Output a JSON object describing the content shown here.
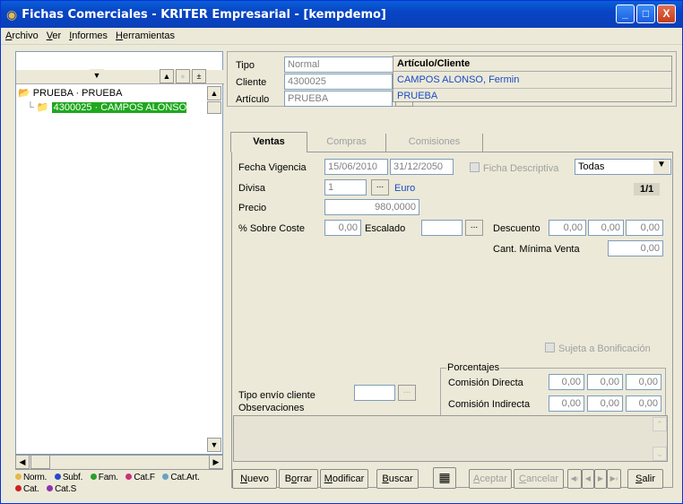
{
  "window": {
    "title": "Fichas Comerciales - KRITER Empresarial -  [kempdemo]",
    "controls": {
      "minimize": "_",
      "maximize": "□",
      "close": "X"
    }
  },
  "menu": {
    "archivo": {
      "ul": "A",
      "rest": "rchivo"
    },
    "ver": {
      "ul": "V",
      "rest": "er"
    },
    "informes": {
      "ul": "I",
      "rest": "nformes"
    },
    "herramientas": {
      "ul": "H",
      "rest": "erramientas"
    }
  },
  "tree": {
    "root": "PRUEBA · PRUEBA",
    "child": "4300025 · CAMPOS ALONSO, Fe"
  },
  "legend": {
    "items": [
      "Norm.",
      "Subf.",
      "Fam.",
      "Cat.F",
      "Cat.Art.",
      "Cat.",
      "Cat.S"
    ],
    "colors": [
      "#e6b84a",
      "#2a4bc8",
      "#2c9c2c",
      "#c8327a",
      "#6aa0c8",
      "#d02020",
      "#9030b0"
    ]
  },
  "header": {
    "tipo_label": "Tipo",
    "tipo_value": "Normal",
    "cliente_label": "Cliente",
    "cliente_value": "4300025",
    "articulo_label": "Artículo",
    "articulo_value": "PRUEBA",
    "info_title": "Artículo/Cliente",
    "info_cliente": "CAMPOS ALONSO, Fermin",
    "info_articulo": "PRUEBA"
  },
  "tabs": {
    "ventas": "Ventas",
    "compras": "Compras",
    "comisiones": "Comisiones"
  },
  "ventas": {
    "fecha_vigencia_label": "Fecha Vigencia",
    "fecha_desde": "15/06/2010",
    "fecha_hasta": "31/12/2050",
    "ficha_descriptiva": "Ficha Descriptiva",
    "todas": "Todas",
    "pagina": "1/1",
    "divisa_label": "Divisa",
    "divisa_value": "1",
    "divisa_name": "Euro",
    "precio_label": "Precio",
    "precio_value": "980,0000",
    "sobre_coste_label": "% Sobre Coste",
    "sobre_coste_value": "0,00",
    "escalado_label": "Escalado",
    "descuento_label": "Descuento",
    "descuento_values": [
      "0,00",
      "0,00",
      "0,00"
    ],
    "cant_minima_label": "Cant. Mínima Venta",
    "cant_minima_value": "0,00",
    "sujeta": "Sujeta a Bonificación",
    "porcentajes": "Porcentajes",
    "comision_directa_label": "Comisión Directa",
    "comision_directa": [
      "0,00",
      "0,00",
      "0,00"
    ],
    "comision_indirecta_label": "Comisión Indirecta",
    "comision_indirecta": [
      "0,00",
      "0,00",
      "0,00"
    ],
    "tipo_envio_label": "Tipo envío cliente",
    "observaciones_label": "Observaciones"
  },
  "buttons": {
    "nuevo": {
      "ul": "N",
      "rest": "uevo"
    },
    "borrar": {
      "pre": "B",
      "ul": "o",
      "rest": "rrar"
    },
    "modificar": {
      "ul": "M",
      "rest": "odificar"
    },
    "buscar": {
      "ul": "B",
      "rest": "uscar"
    },
    "aceptar": {
      "ul": "A",
      "rest": "ceptar"
    },
    "cancelar": {
      "ul": "C",
      "rest": "ancelar"
    },
    "salir": {
      "ul": "S",
      "rest": "alir"
    }
  }
}
